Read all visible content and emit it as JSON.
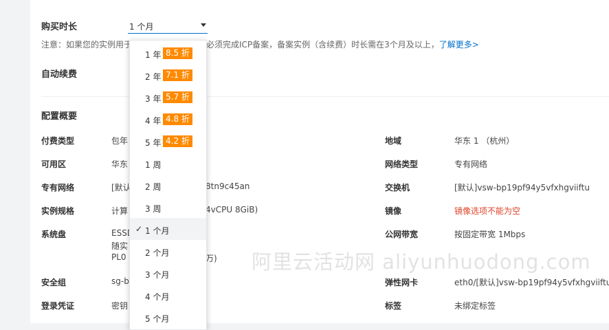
{
  "purchase": {
    "duration_label": "购买时长",
    "selected_value": "1 个月",
    "note_prefix": "注意：如果您的实例用于",
    "note_mid": "必须完成ICP备案，备案实例（含续费）时长需在3个月及以上，",
    "note_link": "了解更多>"
  },
  "auto_renew": {
    "label": "自动续费"
  },
  "config": {
    "title": "配置概要",
    "left": [
      {
        "label": "付费类型",
        "value": "包年"
      },
      {
        "label": "可用区",
        "value": "华东"
      },
      {
        "label": "专有网络",
        "value": "[默认",
        "tail": "8tn9c45an"
      },
      {
        "label": "实例规格",
        "value": "计算",
        "tail": "4vCPU 8GiB)"
      },
      {
        "label": "系统盘",
        "value": "ESSD",
        "line2": "随实",
        "line3": "PL0",
        "tail3": "万)"
      },
      {
        "label": "安全组",
        "value": "sg-b"
      },
      {
        "label": "登录凭证",
        "value": "密钥"
      }
    ],
    "right": [
      {
        "label": "地域",
        "value": "华东 1 （杭州）"
      },
      {
        "label": "网络类型",
        "value": "专有网络"
      },
      {
        "label": "交换机",
        "value": "[默认]vsw-bp19pf94y5vfxhgviiftu"
      },
      {
        "label": "镜像",
        "value": "镜像选项不能为空",
        "error": true
      },
      {
        "label": "公网带宽",
        "value": "按固定带宽 1Mbps"
      },
      {
        "label": "弹性网卡",
        "value": "eth0/[默认]vsw-bp19pf94y5vfxhgviiftu"
      },
      {
        "label": "标签",
        "value": "未绑定标签"
      }
    ]
  },
  "dropdown": {
    "options": [
      {
        "label": "1 年",
        "badge": "8.5 折"
      },
      {
        "label": "2 年",
        "badge": "7.1 折"
      },
      {
        "label": "3 年",
        "badge": "5.7 折"
      },
      {
        "label": "4 年",
        "badge": "4.8 折"
      },
      {
        "label": "5 年",
        "badge": "4.2 折"
      },
      {
        "label": "1 周"
      },
      {
        "label": "2 周"
      },
      {
        "label": "3 周"
      },
      {
        "label": "1 个月",
        "selected": true
      },
      {
        "label": "2 个月"
      },
      {
        "label": "3 个月"
      },
      {
        "label": "4 个月"
      },
      {
        "label": "5 个月"
      }
    ],
    "check_icon": "✓"
  },
  "watermark": "阿里云活动网 aliyunhuodong.com",
  "colors": {
    "accent": "#0070cc",
    "badge": "#ff8a00",
    "error": "#e0442b"
  }
}
